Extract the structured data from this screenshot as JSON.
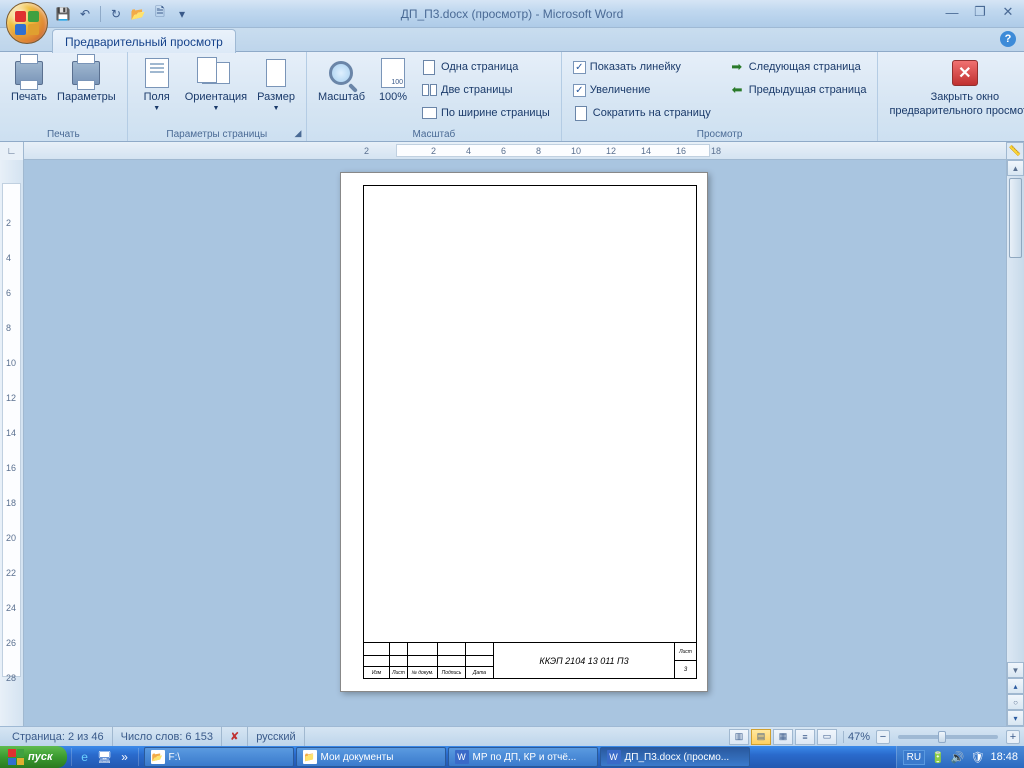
{
  "window": {
    "title": "ДП_П3.docx (просмотр) - Microsoft Word"
  },
  "qat": {
    "save": "💾",
    "undo": "↶",
    "redo": "↻",
    "open": "📂",
    "new": "🗎"
  },
  "tabs": {
    "active": "Предварительный просмотр"
  },
  "ribbon": {
    "print_label": "Печать",
    "options_label": "Параметры",
    "group_print": "Печать",
    "margins_label": "Поля",
    "orientation_label": "Ориентация",
    "size_label": "Размер",
    "group_page": "Параметры страницы",
    "zoom_label": "Масштаб",
    "pct100_label": "100%",
    "one_page": "Одна страница",
    "two_pages": "Две страницы",
    "page_width": "По ширине страницы",
    "group_zoom": "Масштаб",
    "show_ruler": "Показать линейку",
    "magnifier": "Увеличение",
    "shrink": "Сократить на страницу",
    "next_page": "Следующая страница",
    "prev_page": "Предыдущая страница",
    "group_view": "Просмотр",
    "close_1": "Закрыть окно",
    "close_2": "предварительного просмотра"
  },
  "hruler": {
    "neg": "2",
    "ticks": [
      "2",
      "4",
      "6",
      "8",
      "10",
      "12",
      "14",
      "16",
      "18"
    ]
  },
  "vruler": {
    "ticks": [
      "2",
      "4",
      "6",
      "8",
      "10",
      "12",
      "14",
      "16",
      "18",
      "20",
      "22",
      "24",
      "26",
      "28"
    ]
  },
  "doc": {
    "stamp_code": "ККЭП 2104 13  011  П3",
    "page_no": "3",
    "sheet": "Лист",
    "cells": [
      "Изм",
      "Лист",
      "№ докум.",
      "Подпись",
      "Дата"
    ]
  },
  "status": {
    "page": "Страница: 2 из 46",
    "words": "Число слов: 6 153",
    "lang": "русский",
    "zoom_pct": "47%"
  },
  "taskbar": {
    "start": "пуск",
    "items": [
      {
        "label": "F:\\",
        "icon": "📂"
      },
      {
        "label": "Мои документы",
        "icon": "📁"
      },
      {
        "label": "МР по ДП, КР и отчё...",
        "icon": "W"
      },
      {
        "label": "ДП_П3.docx (просмо...",
        "icon": "W",
        "active": true
      }
    ],
    "lang": "RU",
    "clock": "18:48"
  }
}
